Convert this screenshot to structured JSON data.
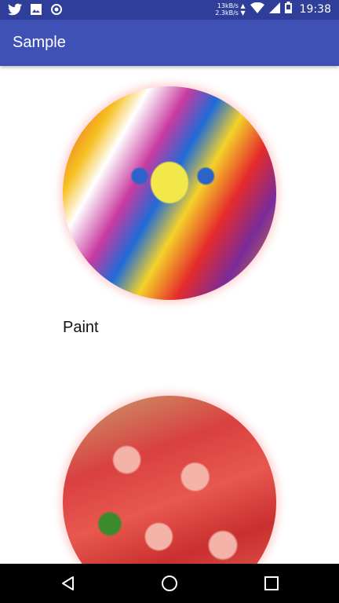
{
  "status_bar": {
    "time": "19:38",
    "net_up": "13kB/s ▲",
    "net_down": "2.3kB/s ▼",
    "icons": [
      "twitter-icon",
      "image-icon",
      "sync-icon",
      "wifi-icon",
      "signal-icon",
      "battery-icon"
    ]
  },
  "app_bar": {
    "title": "Sample"
  },
  "cards": [
    {
      "caption": "Paint",
      "image": "face-paint-photo"
    },
    {
      "caption": "",
      "image": "strawberries-photo"
    }
  ],
  "nav_bar": {
    "icons": [
      "back-icon",
      "home-icon",
      "recents-icon"
    ]
  },
  "colors": {
    "app_bar": "#3f51b5",
    "status_bar": "#2f3f99",
    "nav_bar": "#000000"
  }
}
